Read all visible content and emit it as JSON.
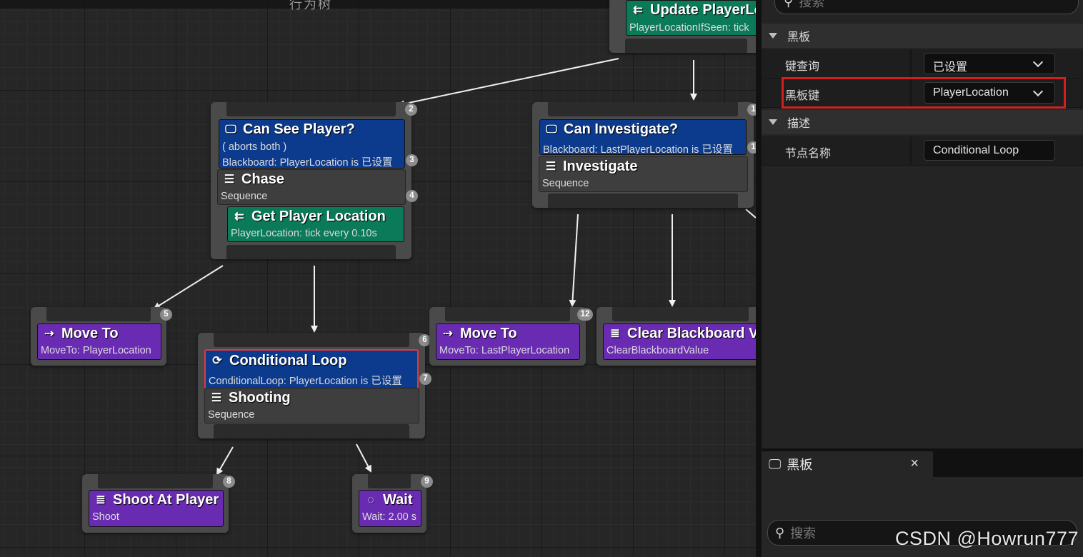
{
  "graph": {
    "title": "行为树",
    "nodes": {
      "update": {
        "title": "Update PlayerLo",
        "sub": "PlayerLocationIfSeen: tick"
      },
      "can_see": {
        "badges": [
          "2",
          "3",
          "4"
        ],
        "decorator_title": "Can See Player?",
        "decorator_sub1": "( aborts both )",
        "decorator_sub2": "Blackboard: PlayerLocation is 已设置",
        "composite_title": "Chase",
        "composite_sub": "Sequence",
        "service_title": "Get Player Location",
        "service_sub": "PlayerLocation: tick every 0.10s"
      },
      "can_investigate": {
        "badges": [
          "1",
          "1"
        ],
        "decorator_title": "Can Investigate?",
        "decorator_sub": "Blackboard: LastPlayerLocation is 已设置",
        "composite_title": "Investigate",
        "composite_sub": "Sequence"
      },
      "move_to_player": {
        "badge": "5",
        "title": "Move To",
        "sub": "MoveTo: PlayerLocation"
      },
      "conditional": {
        "badges": [
          "6",
          "7"
        ],
        "decorator_title": "Conditional Loop",
        "decorator_sub": "ConditionalLoop: PlayerLocation is 已设置",
        "composite_title": "Shooting",
        "composite_sub": "Sequence"
      },
      "move_to_last": {
        "badge": "12",
        "title": "Move To",
        "sub": "MoveTo: LastPlayerLocation"
      },
      "clear_bb": {
        "title": "Clear Blackboard Va",
        "sub": "ClearBlackboardValue"
      },
      "shoot": {
        "badge": "8",
        "title": "Shoot At Player",
        "sub": "Shoot"
      },
      "wait": {
        "badge": "9",
        "title": "Wait",
        "sub": "Wait: 2.00 s"
      }
    }
  },
  "details": {
    "search_placeholder": "搜索",
    "section_blackboard": "黑板",
    "key_query_label": "键查询",
    "key_query_value": "已设置",
    "blackboard_key_label": "黑板键",
    "blackboard_key_value": "PlayerLocation",
    "section_description": "描述",
    "node_name_label": "节点名称",
    "node_name_value": "Conditional Loop",
    "highlight_color": "#d01f1f"
  },
  "blackboard_panel": {
    "tab_label": "黑板",
    "close": "×",
    "search_placeholder": "搜索"
  },
  "watermark": "CSDN @Howrun777",
  "colors": {
    "decorator": "#0c3a8c",
    "service": "#0b7a58",
    "task": "#6a2bb3",
    "composite": "#3e3e3e",
    "selection": "#e0393a"
  }
}
